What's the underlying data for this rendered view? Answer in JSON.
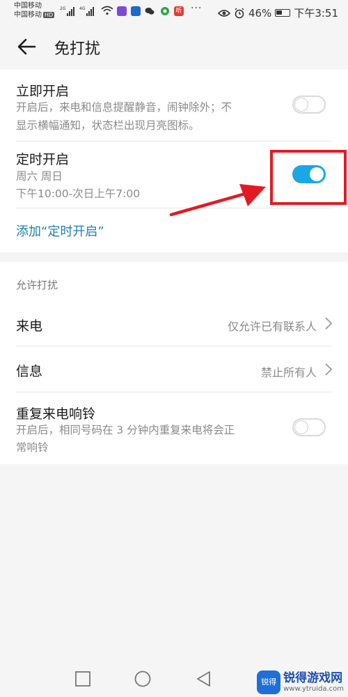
{
  "status_bar": {
    "carrier1": "中国移动",
    "carrier2": "中国移动",
    "hd_badge": "HD",
    "sig1_type": "2G",
    "sig2_type": "4G",
    "notif_app": "听",
    "more": "···",
    "battery": "46%",
    "time": "下午3:51"
  },
  "header": {
    "title": "免打扰"
  },
  "immediate": {
    "title": "立即开启",
    "desc_line1": "开启后，来电和信息提醒静音，闹钟除外；不",
    "desc_line2": "显示横幅通知，状态栏出现月亮图标。",
    "enabled": false
  },
  "scheduled": {
    "title": "定时开启",
    "days": "周六 周日",
    "time_range": "下午10:00-次日上午7:00",
    "enabled": true
  },
  "add_schedule": "添加“定时开启”",
  "allow": {
    "section_label": "允许打扰",
    "calls_label": "来电",
    "calls_value": "仅允许已有联系人",
    "messages_label": "信息",
    "messages_value": "禁止所有人",
    "repeat_title": "重复来电响铃",
    "repeat_desc_line1": "开启后，相同号码在 3 分钟内重复来电将会正",
    "repeat_desc_line2": "常响铃",
    "repeat_enabled": false
  },
  "watermark": {
    "logo": "锐得",
    "name": "锐得游戏网",
    "url": "www.ytruida.com"
  },
  "colors": {
    "accent": "#1aa7e6",
    "link": "#1b7fb2",
    "annotation_red": "#e21b23"
  },
  "icons": {
    "back": "back-arrow-icon",
    "chevron": "chevron-right-icon",
    "nav_recents": "square-icon",
    "nav_home": "circle-icon",
    "nav_back": "triangle-icon"
  }
}
